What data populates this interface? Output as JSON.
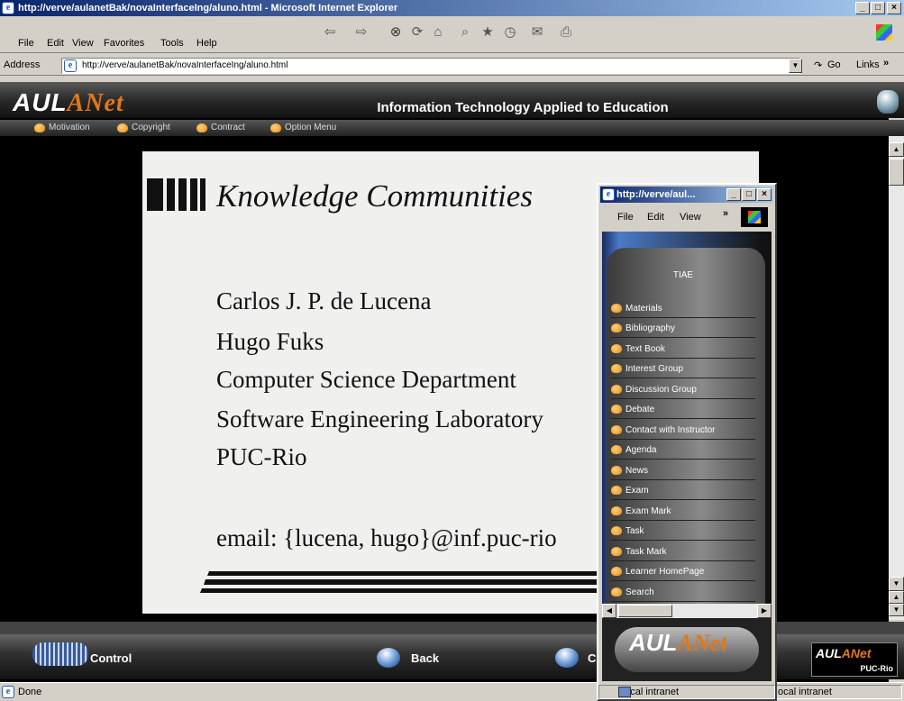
{
  "window": {
    "title": "http://verve/aulanetBak/novaInterfaceIng/aluno.html - Microsoft Internet Explorer",
    "menu": [
      "File",
      "Edit",
      "View",
      "Favorites",
      "Tools",
      "Help"
    ],
    "address_label": "Address",
    "address": "http://verve/aulanetBak/novaInterfaceIng/aluno.html",
    "go_label": "Go",
    "links_label": "Links",
    "links_chevron": "»"
  },
  "banner": {
    "logo_main": "AUL",
    "logo_net": "ANet",
    "title": "Information Technology Applied to Education"
  },
  "nav": [
    "Motivation",
    "Copyright",
    "Contract",
    "Option Menu"
  ],
  "slide": {
    "title": "Knowledge Communities",
    "lines": [
      "Carlos J. P. de Lucena",
      "Hugo Fuks",
      "Computer Science Department",
      "Software Engineering Laboratory",
      "PUC-Rio"
    ],
    "email": "email: {lucena, hugo}@inf.puc-rio"
  },
  "footer": {
    "control": "Control",
    "back": "Back",
    "c_partial": "C",
    "logo_sub": "PUC-Rio"
  },
  "status": {
    "done": "Done",
    "zone_popup": "Local intranet",
    "zone_main": "ocal intranet"
  },
  "popup": {
    "title": "http://verve/aul...",
    "menu": [
      "File",
      "Edit",
      "View"
    ],
    "menu_chevron": "»",
    "header": "TIAE",
    "items": [
      "Materials",
      "Bibliography",
      "Text Book",
      "Interest Group",
      "Discussion Group",
      "Debate",
      "Contact with Instructor",
      "Agenda",
      "News",
      "Exam",
      "Exam Mark",
      "Task",
      "Task Mark",
      "Learner HomePage",
      "Search"
    ]
  },
  "colors": {
    "accent": "#e07818",
    "titlebar": "#0a246a",
    "chrome": "#d4d0c8"
  }
}
